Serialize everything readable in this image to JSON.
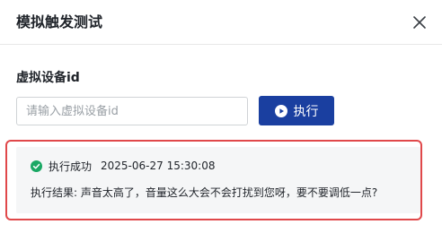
{
  "dialog": {
    "title": "模拟触发测试",
    "close_icon": "close-icon"
  },
  "form": {
    "label": "虚拟设备id",
    "input_value": "",
    "input_placeholder": "请输入虚拟设备id",
    "exec_label": "执行",
    "exec_icon": "play-circle-icon",
    "exec_color": "#1a3fa0"
  },
  "result": {
    "status_icon": "check-circle-icon",
    "status_color": "#1aa864",
    "status_text": "执行成功",
    "timestamp": "2025-06-27 15:30:08",
    "text": "执行结果: 声音太高了，音量这么大会不会打扰到您呀，要不要调低一点?",
    "highlight_color": "#e0484a"
  }
}
